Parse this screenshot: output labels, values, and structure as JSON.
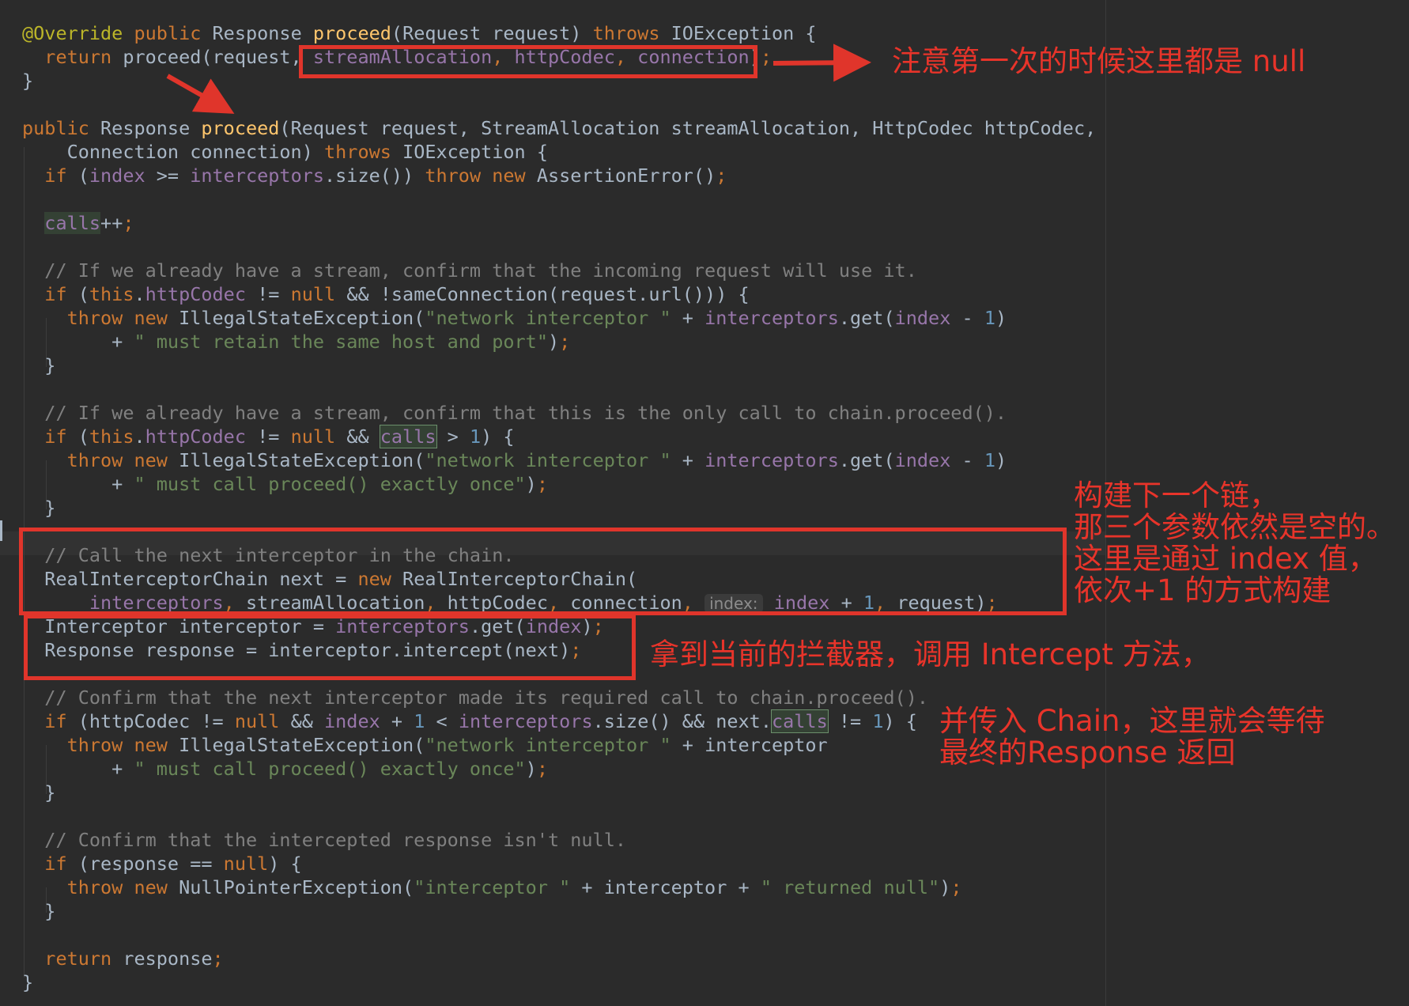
{
  "code": {
    "lines": [
      [
        [
          "a",
          "@Override"
        ],
        [
          "p",
          " "
        ],
        [
          "k",
          "public"
        ],
        [
          "p",
          " Response "
        ],
        [
          "f",
          "proceed"
        ],
        [
          "p",
          "(Request request) "
        ],
        [
          "k",
          "throws"
        ],
        [
          "p",
          " IOException {"
        ]
      ],
      [
        [
          "p",
          "  "
        ],
        [
          "k",
          "return"
        ],
        [
          "p",
          " proceed(request, "
        ],
        [
          "v",
          "streamAllocation"
        ],
        [
          "k",
          ", "
        ],
        [
          "v",
          "httpCodec"
        ],
        [
          "k",
          ", "
        ],
        [
          "v",
          "connection"
        ],
        [
          "p",
          ")"
        ],
        [
          "k",
          ";"
        ]
      ],
      [
        [
          "p",
          "}"
        ]
      ],
      [],
      [
        [
          "k",
          "public"
        ],
        [
          "p",
          " Response "
        ],
        [
          "f",
          "proceed"
        ],
        [
          "p",
          "(Request request, StreamAllocation streamAllocation, HttpCodec httpCodec,"
        ]
      ],
      [
        [
          "p",
          "    Connection connection) "
        ],
        [
          "k",
          "throws"
        ],
        [
          "p",
          " IOException {"
        ]
      ],
      [
        [
          "p",
          "  "
        ],
        [
          "k",
          "if"
        ],
        [
          "p",
          " ("
        ],
        [
          "v",
          "index"
        ],
        [
          "p",
          " >= "
        ],
        [
          "v",
          "interceptors"
        ],
        [
          "p",
          ".size()) "
        ],
        [
          "k",
          "throw new"
        ],
        [
          "p",
          " AssertionError()"
        ],
        [
          "k",
          ";"
        ]
      ],
      [],
      [
        [
          "p",
          "  "
        ],
        [
          "vhl",
          "calls"
        ],
        [
          "p",
          "++"
        ],
        [
          "k",
          ";"
        ]
      ],
      [],
      [
        [
          "p",
          "  "
        ],
        [
          "c",
          "// If we already have a stream, confirm that the incoming request will use it."
        ]
      ],
      [
        [
          "p",
          "  "
        ],
        [
          "k",
          "if"
        ],
        [
          "p",
          " ("
        ],
        [
          "k",
          "this"
        ],
        [
          "p",
          "."
        ],
        [
          "v",
          "httpCodec"
        ],
        [
          "p",
          " != "
        ],
        [
          "k",
          "null"
        ],
        [
          "p",
          " && !sameConnection(request.url())) {"
        ]
      ],
      [
        [
          "p",
          "    "
        ],
        [
          "k",
          "throw new"
        ],
        [
          "p",
          " IllegalStateException("
        ],
        [
          "s",
          "\"network interceptor \""
        ],
        [
          "p",
          " + "
        ],
        [
          "v",
          "interceptors"
        ],
        [
          "p",
          ".get("
        ],
        [
          "v",
          "index"
        ],
        [
          "p",
          " - "
        ],
        [
          "n",
          "1"
        ],
        [
          "p",
          ")"
        ]
      ],
      [
        [
          "p",
          "        + "
        ],
        [
          "s",
          "\" must retain the same host and port\""
        ],
        [
          "p",
          ")"
        ],
        [
          "k",
          ";"
        ]
      ],
      [
        [
          "p",
          "  }"
        ]
      ],
      [],
      [
        [
          "p",
          "  "
        ],
        [
          "c",
          "// If we already have a stream, confirm that this is the only call to chain.proceed()."
        ]
      ],
      [
        [
          "p",
          "  "
        ],
        [
          "k",
          "if"
        ],
        [
          "p",
          " ("
        ],
        [
          "k",
          "this"
        ],
        [
          "p",
          "."
        ],
        [
          "v",
          "httpCodec"
        ],
        [
          "p",
          " != "
        ],
        [
          "k",
          "null"
        ],
        [
          "p",
          " && "
        ],
        [
          "vhlb",
          "calls"
        ],
        [
          "p",
          " > "
        ],
        [
          "n",
          "1"
        ],
        [
          "p",
          ") {"
        ]
      ],
      [
        [
          "p",
          "    "
        ],
        [
          "k",
          "throw new"
        ],
        [
          "p",
          " IllegalStateException("
        ],
        [
          "s",
          "\"network interceptor \""
        ],
        [
          "p",
          " + "
        ],
        [
          "v",
          "interceptors"
        ],
        [
          "p",
          ".get("
        ],
        [
          "v",
          "index"
        ],
        [
          "p",
          " - "
        ],
        [
          "n",
          "1"
        ],
        [
          "p",
          ")"
        ]
      ],
      [
        [
          "p",
          "        + "
        ],
        [
          "s",
          "\" must call proceed() exactly once\""
        ],
        [
          "p",
          ")"
        ],
        [
          "k",
          ";"
        ]
      ],
      [
        [
          "p",
          "  }"
        ]
      ],
      [],
      [
        [
          "p",
          "  "
        ],
        [
          "c",
          "// Call the next interceptor in the chain."
        ]
      ],
      [
        [
          "p",
          "  RealInterceptorChain next = "
        ],
        [
          "k",
          "new"
        ],
        [
          "p",
          " RealInterceptorChain("
        ]
      ],
      [
        [
          "p",
          "      "
        ],
        [
          "v",
          "interceptors"
        ],
        [
          "k",
          ", "
        ],
        [
          "p",
          "streamAllocation"
        ],
        [
          "k",
          ", "
        ],
        [
          "p",
          "httpCodec"
        ],
        [
          "k",
          ", "
        ],
        [
          "p",
          "connection"
        ],
        [
          "k",
          ", "
        ],
        [
          "hint",
          "index:"
        ],
        [
          "p",
          " "
        ],
        [
          "v",
          "index"
        ],
        [
          "p",
          " + "
        ],
        [
          "n",
          "1"
        ],
        [
          "k",
          ", "
        ],
        [
          "p",
          "request)"
        ],
        [
          "k",
          ";"
        ]
      ],
      [
        [
          "p",
          "  Interceptor interceptor = "
        ],
        [
          "v",
          "interceptors"
        ],
        [
          "p",
          ".get("
        ],
        [
          "v",
          "index"
        ],
        [
          "p",
          ")"
        ],
        [
          "k",
          ";"
        ]
      ],
      [
        [
          "p",
          "  Response response = interceptor.intercept(next)"
        ],
        [
          "k",
          ";"
        ]
      ],
      [],
      [
        [
          "p",
          "  "
        ],
        [
          "c",
          "// Confirm that the next interceptor made its required call to chain.proceed()."
        ]
      ],
      [
        [
          "p",
          "  "
        ],
        [
          "k",
          "if"
        ],
        [
          "p",
          " (httpCodec != "
        ],
        [
          "k",
          "null"
        ],
        [
          "p",
          " && "
        ],
        [
          "v",
          "index"
        ],
        [
          "p",
          " + "
        ],
        [
          "n",
          "1"
        ],
        [
          "p",
          " < "
        ],
        [
          "v",
          "interceptors"
        ],
        [
          "p",
          ".size() && next."
        ],
        [
          "vhlb",
          "calls"
        ],
        [
          "p",
          " != "
        ],
        [
          "n",
          "1"
        ],
        [
          "p",
          ") {"
        ]
      ],
      [
        [
          "p",
          "    "
        ],
        [
          "k",
          "throw new"
        ],
        [
          "p",
          " IllegalStateException("
        ],
        [
          "s",
          "\"network interceptor \""
        ],
        [
          "p",
          " + interceptor"
        ]
      ],
      [
        [
          "p",
          "        + "
        ],
        [
          "s",
          "\" must call proceed() exactly once\""
        ],
        [
          "p",
          ")"
        ],
        [
          "k",
          ";"
        ]
      ],
      [
        [
          "p",
          "  }"
        ]
      ],
      [],
      [
        [
          "p",
          "  "
        ],
        [
          "c",
          "// Confirm that the intercepted response isn't null."
        ]
      ],
      [
        [
          "p",
          "  "
        ],
        [
          "k",
          "if"
        ],
        [
          "p",
          " (response == "
        ],
        [
          "k",
          "null"
        ],
        [
          "p",
          ") {"
        ]
      ],
      [
        [
          "p",
          "    "
        ],
        [
          "k",
          "throw new"
        ],
        [
          "p",
          " NullPointerException("
        ],
        [
          "s",
          "\"interceptor \""
        ],
        [
          "p",
          " + interceptor + "
        ],
        [
          "s",
          "\" returned null\""
        ],
        [
          "p",
          ")"
        ],
        [
          "k",
          ";"
        ]
      ],
      [
        [
          "p",
          "  }"
        ]
      ],
      [],
      [
        [
          "p",
          "  "
        ],
        [
          "k",
          "return"
        ],
        [
          "p",
          " response"
        ],
        [
          "k",
          ";"
        ]
      ],
      [
        [
          "p",
          "}"
        ]
      ]
    ]
  },
  "annotations": {
    "first_call_null": "注意第一次的时候这里都是 null",
    "next_chain": "构建下一个链，\n那三个参数依然是空的。\n这里是通过 index 值，\n依次+1 的方式构建",
    "intercept_call": "拿到当前的拦截器，调用 Intercept 方法，",
    "wait_response": "并传入 Chain，这里就会等待\n最终的Response 返回"
  },
  "colors": {
    "background": "#2b2b2b",
    "keyword": "#cc7832",
    "annotation_red": "#e0352b",
    "string": "#6a8759",
    "field": "#9876aa",
    "comment": "#808080"
  }
}
